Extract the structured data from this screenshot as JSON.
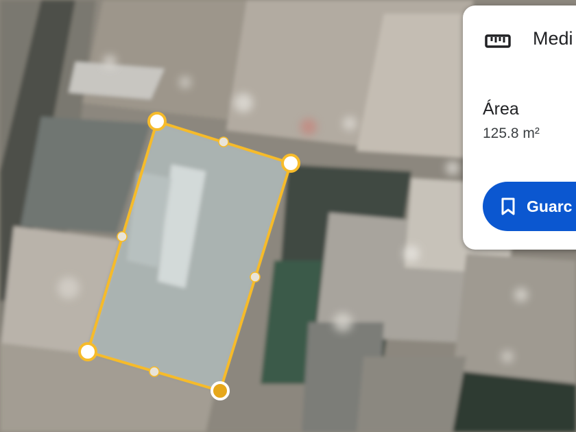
{
  "panel": {
    "title": "Medi",
    "area_label": "Área",
    "area_value": "125.8 m²",
    "save_label": "Guarc",
    "measure_icon": "ruler-icon",
    "save_icon": "bookmark-icon"
  },
  "colors": {
    "measurement_line": "#f6bb2a",
    "primary_button": "#0b57d0"
  }
}
